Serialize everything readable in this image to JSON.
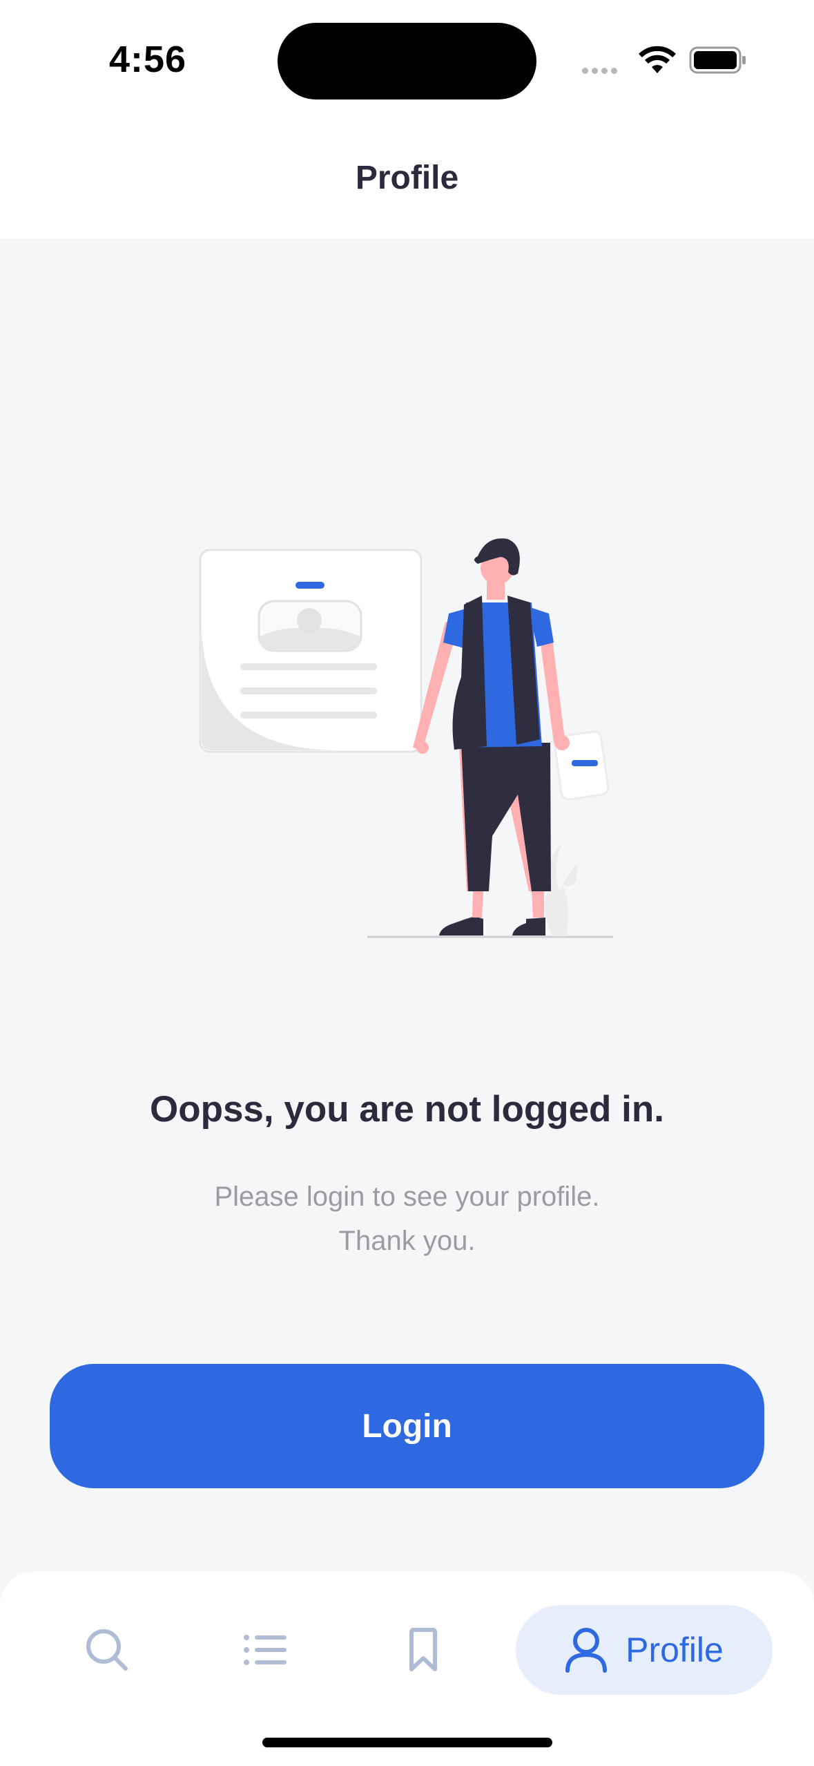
{
  "status_bar": {
    "time": "4:56"
  },
  "header": {
    "title": "Profile"
  },
  "empty_state": {
    "title": "Oopss, you are not logged in.",
    "message_line1": "Please login to see your profile.",
    "message_line2": "Thank you."
  },
  "login_button": {
    "label": "Login"
  },
  "tab_bar": {
    "tabs": [
      {
        "icon": "search-icon",
        "label": "",
        "selected": false
      },
      {
        "icon": "list-icon",
        "label": "",
        "selected": false
      },
      {
        "icon": "bookmark-icon",
        "label": "",
        "selected": false
      },
      {
        "icon": "user-icon",
        "label": "Profile",
        "selected": true
      }
    ]
  },
  "colors": {
    "accent": "#2e69e1",
    "background": "#f5f6f8",
    "title_text": "#2a2b3d",
    "muted_text": "#9a9ca3",
    "tab_selected_bg": "#e7eefb",
    "tab_inactive": "#aebcd6"
  }
}
